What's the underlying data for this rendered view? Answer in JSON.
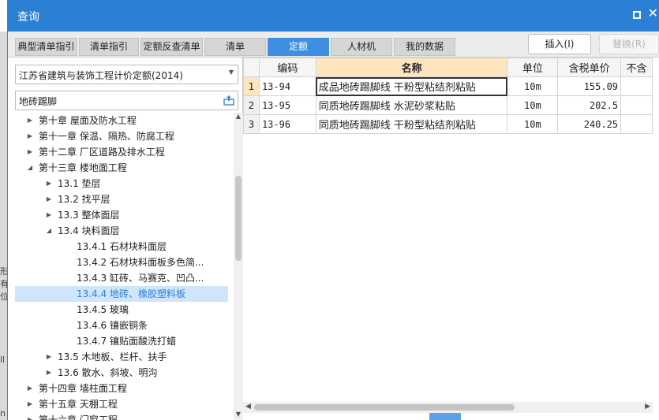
{
  "window": {
    "title": "查询"
  },
  "left_bg_fragments": [
    "形",
    "有",
    "位",
    "ll",
    "n"
  ],
  "tabs": [
    {
      "label": "典型清单指引"
    },
    {
      "label": "清单指引"
    },
    {
      "label": "定额反查清单"
    },
    {
      "label": "清单"
    },
    {
      "label": "定额",
      "active": true
    },
    {
      "label": "人材机"
    },
    {
      "label": "我的数据"
    }
  ],
  "buttons": {
    "insert": "插入(I)",
    "replace": "替换(R)"
  },
  "left": {
    "norm_select": "江苏省建筑与装饰工程计价定额(2014)",
    "search_value": "地砖踢脚",
    "tree": [
      {
        "label": "第十章 屋面及防水工程",
        "level": 1,
        "arrow": "collapsed"
      },
      {
        "label": "第十一章 保温、隔热、防腐工程",
        "level": 1,
        "arrow": "collapsed"
      },
      {
        "label": "第十二章 厂区道路及排水工程",
        "level": 1,
        "arrow": "collapsed"
      },
      {
        "label": "第十三章 楼地面工程",
        "level": 1,
        "arrow": "expanded"
      },
      {
        "label": "13.1 垫层",
        "level": 2,
        "arrow": "collapsed"
      },
      {
        "label": "13.2 找平层",
        "level": 2,
        "arrow": "collapsed"
      },
      {
        "label": "13.3 整体面层",
        "level": 2,
        "arrow": "collapsed"
      },
      {
        "label": "13.4 块料面层",
        "level": 2,
        "arrow": "expanded"
      },
      {
        "label": "13.4.1 石材块料面层",
        "level": 3,
        "arrow": "none"
      },
      {
        "label": "13.4.2 石材块料面板多色简...",
        "level": 3,
        "arrow": "none"
      },
      {
        "label": "13.4.3 缸砖、马赛克、凹凸...",
        "level": 3,
        "arrow": "none"
      },
      {
        "label": "13.4.4 地砖、橡胶塑料板",
        "level": 3,
        "arrow": "none",
        "selected": true
      },
      {
        "label": "13.4.5 玻璃",
        "level": 3,
        "arrow": "none"
      },
      {
        "label": "13.4.6 镶嵌铜条",
        "level": 3,
        "arrow": "none"
      },
      {
        "label": "13.4.7 镶贴面酸洗打蜡",
        "level": 3,
        "arrow": "none"
      },
      {
        "label": "13.5 木地板、栏杆、扶手",
        "level": 2,
        "arrow": "collapsed"
      },
      {
        "label": "13.6 散水、斜坡、明沟",
        "level": 2,
        "arrow": "collapsed"
      },
      {
        "label": "第十四章 墙柱面工程",
        "level": 1,
        "arrow": "collapsed"
      },
      {
        "label": "第十五章 天棚工程",
        "level": 1,
        "arrow": "collapsed"
      },
      {
        "label": "第十六章 门窗工程",
        "level": 1,
        "arrow": "collapsed"
      }
    ]
  },
  "grid": {
    "headers": {
      "code": "编码",
      "name": "名称",
      "unit": "单位",
      "price": "含税单价",
      "extra": "不含"
    },
    "rows": [
      {
        "idx": "1",
        "code": "13-94",
        "name": "成品地砖踢脚线 干粉型粘结剂粘贴",
        "unit": "10m",
        "price": "155.09"
      },
      {
        "idx": "2",
        "code": "13-95",
        "name": "同质地砖踢脚线 水泥砂浆粘贴",
        "unit": "10m",
        "price": "202.5"
      },
      {
        "idx": "3",
        "code": "13-96",
        "name": "同质地砖踢脚线 干粉型粘结剂粘贴",
        "unit": "10m",
        "price": "240.25"
      }
    ]
  },
  "colors": {
    "accent": "#2b7fd4",
    "selected_tab": "#3e8fe0",
    "header_highlight": "#fce5bf",
    "tree_selected": "#cfe5fb"
  }
}
